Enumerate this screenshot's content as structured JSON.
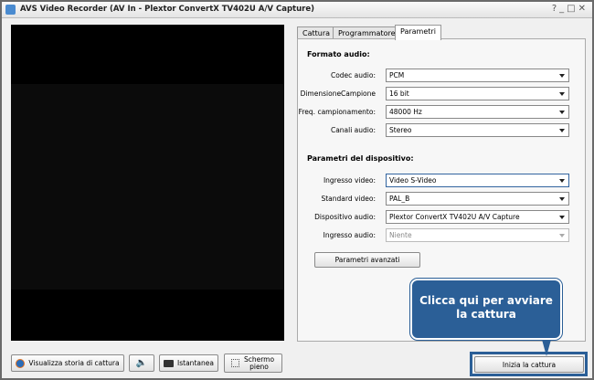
{
  "window": {
    "title": "AVS Video Recorder (AV In - Plextor ConvertX TV402U A/V Capture)",
    "controls": "?_□✕"
  },
  "tabs": [
    {
      "label": "Cattura"
    },
    {
      "label": "Programmatore"
    },
    {
      "label": "Parametri",
      "active": true
    }
  ],
  "audio": {
    "heading": "Formato audio:",
    "rows": [
      {
        "label": "Codec audio:",
        "value": "PCM"
      },
      {
        "label": "DimensioneCampione",
        "value": "16 bit"
      },
      {
        "label": "Freq. campionamento:",
        "value": "48000 Hz"
      },
      {
        "label": "Canali audio:",
        "value": "Stereo"
      }
    ]
  },
  "device": {
    "heading": "Parametri del dispositivo:",
    "rows": [
      {
        "label": "Ingresso video:",
        "value": "Video S-Video"
      },
      {
        "label": "Standard video:",
        "value": "PAL_B"
      },
      {
        "label": "Dispositivo audio:",
        "value": "Plextor ConvertX TV402U A/V Capture"
      },
      {
        "label": "Ingresso audio:",
        "value": "Niente",
        "disabled": true
      }
    ]
  },
  "advanced_button": "Parametri avanzati",
  "bottom": {
    "history": "Visualizza storia di cattura",
    "snapshot": "Istantanea",
    "fullscreen": "Schermo pieno",
    "start": "Inizia la cattura"
  },
  "callout": "Clicca qui per avviare la cattura",
  "colors": {
    "accent": "#2b5f97"
  }
}
